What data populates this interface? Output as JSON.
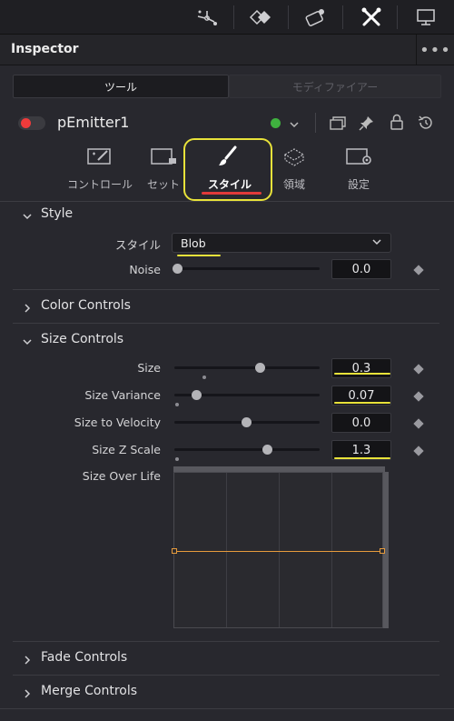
{
  "header": {
    "title": "Inspector",
    "more": "•••"
  },
  "tabs": {
    "tools": "ツール",
    "modifiers": "モディファイアー"
  },
  "node": {
    "name": "pEmitter1"
  },
  "categories": [
    {
      "label": "コントロール"
    },
    {
      "label": "セット"
    },
    {
      "label": "スタイル"
    },
    {
      "label": "領域"
    },
    {
      "label": "設定"
    }
  ],
  "style_section": {
    "title": "Style",
    "style_label": "スタイル",
    "style_value": "Blob",
    "noise_label": "Noise",
    "noise_value": "0.0"
  },
  "color_controls": {
    "title": "Color Controls"
  },
  "size_controls": {
    "title": "Size Controls",
    "size_label": "Size",
    "size_value": "0.3",
    "variance_label": "Size Variance",
    "variance_value": "0.07",
    "velocity_label": "Size to Velocity",
    "velocity_value": "0.0",
    "zscale_label": "Size Z Scale",
    "zscale_value": "1.3",
    "overlife_label": "Size Over Life"
  },
  "fade_controls": {
    "title": "Fade Controls"
  },
  "merge_controls": {
    "title": "Merge Controls"
  },
  "colors": {
    "accent_red": "#e23a3a",
    "highlight_yellow": "#e8e23a",
    "curve_orange": "#e69b3c",
    "status_green": "#3fb13f"
  }
}
